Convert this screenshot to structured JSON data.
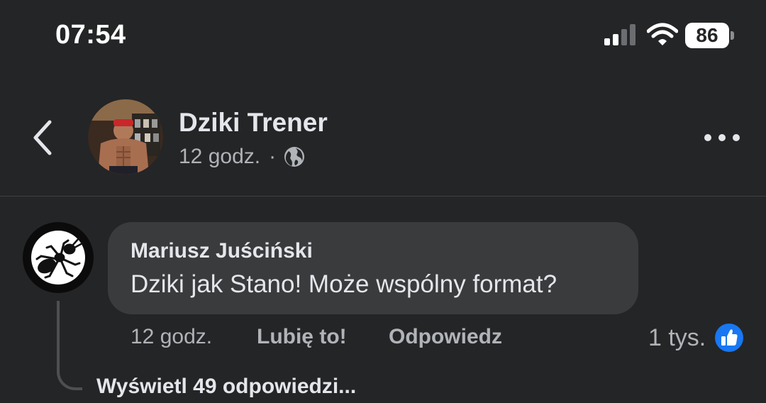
{
  "status_bar": {
    "time": "07:54",
    "battery": "86",
    "icons": [
      "cellular-signal-icon",
      "wifi-icon",
      "battery-icon"
    ]
  },
  "post": {
    "page_name": "Dziki Trener",
    "time": "12 godz.",
    "separator": "·",
    "icons": [
      "back-icon",
      "globe-icon",
      "more-icon"
    ]
  },
  "comment": {
    "author": "Mariusz Juściński",
    "text": "Dziki jak Stano! Może wspólny format?",
    "time": "12 godz.",
    "like_label": "Lubię to!",
    "reply_label": "Odpowiedz",
    "reaction_count": "1 tys.",
    "view_replies": "Wyświetl 49 odpowiedzi..."
  },
  "colors": {
    "background": "#242526",
    "bubble": "#3a3b3c",
    "text_primary": "#e4e6eb",
    "text_secondary": "#b0b3b8",
    "like_blue": "#1877f2"
  }
}
